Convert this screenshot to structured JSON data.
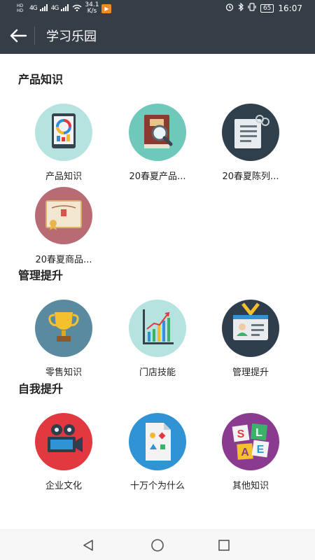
{
  "status_bar": {
    "hd1": "HD",
    "hd2": "HD",
    "net1": "4G",
    "net2": "4G",
    "speed_value": "34.1",
    "speed_unit": "K/s",
    "battery": "65",
    "time": "16:07"
  },
  "header": {
    "title": "学习乐园"
  },
  "sections": [
    {
      "title": "产品知识",
      "items": [
        {
          "label": "产品知识",
          "icon": "tablet-chart-icon",
          "color": "#b6e3e0"
        },
        {
          "label": "20春夏产品...",
          "icon": "book-magnifier-icon",
          "color": "#6ec9bb"
        },
        {
          "label": "20春夏陈列...",
          "icon": "notebook-icon",
          "color": "#2f3f4b"
        },
        {
          "label": "20春夏商品...",
          "icon": "certificate-icon",
          "color": "#b96b74"
        }
      ]
    },
    {
      "title": "管理提升",
      "items": [
        {
          "label": "零售知识",
          "icon": "trophy-icon",
          "color": "#5a8aa0"
        },
        {
          "label": "门店技能",
          "icon": "bar-chart-icon",
          "color": "#b5e3df"
        },
        {
          "label": "管理提升",
          "icon": "id-badge-icon",
          "color": "#2f3e4d"
        }
      ]
    },
    {
      "title": "自我提升",
      "items": [
        {
          "label": "企业文化",
          "icon": "video-camera-icon",
          "color": "#e2383f"
        },
        {
          "label": "十万个为什么",
          "icon": "shapes-document-icon",
          "color": "#2f93d6"
        },
        {
          "label": "其他知识",
          "icon": "letter-blocks-icon",
          "color": "#8a3b8f"
        }
      ]
    }
  ],
  "blocks": [
    "S",
    "L",
    "A",
    "E"
  ]
}
